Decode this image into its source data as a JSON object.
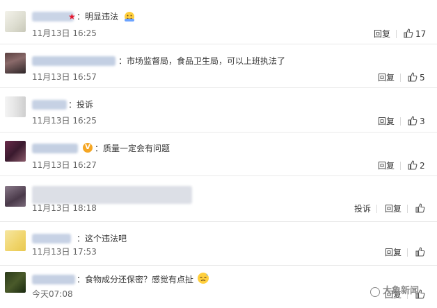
{
  "colors": {
    "text": "#333333",
    "time": "#666666",
    "divider": "#e8e8e8",
    "star": "#e6162d",
    "verified": "#f5a623"
  },
  "comments": [
    {
      "emblem": "★",
      "text": "明显违法",
      "emoji_icon": "smiling-face-emoji",
      "time": "11月13日 16:25",
      "reply": "回复",
      "likes": "17"
    },
    {
      "text": "市场监督局，食品卫生局，可以上班执法了",
      "time": "11月13日 16:57",
      "reply": "回复",
      "likes": "5"
    },
    {
      "text": "投诉",
      "time": "11月13日 16:25",
      "reply": "回复",
      "likes": "3"
    },
    {
      "verified": "V",
      "text": "质量一定会有问题",
      "time": "11月13日 16:27",
      "reply": "回复",
      "likes": "2"
    },
    {
      "text": "",
      "time": "11月13日 18:18",
      "report": "投诉",
      "reply": "回复",
      "likes": ""
    },
    {
      "text": "这个违法吧",
      "time": "11月13日 17:53",
      "reply": "回复",
      "likes": ""
    },
    {
      "text": "食物成分还保密？感觉有点扯",
      "emoji_icon": "sweat-face-emoji",
      "time": "今天07:08",
      "reply": "回复",
      "likes": ""
    }
  ],
  "watermark": {
    "text": "大象新闻",
    "icon": "watermark-logo-icon"
  }
}
